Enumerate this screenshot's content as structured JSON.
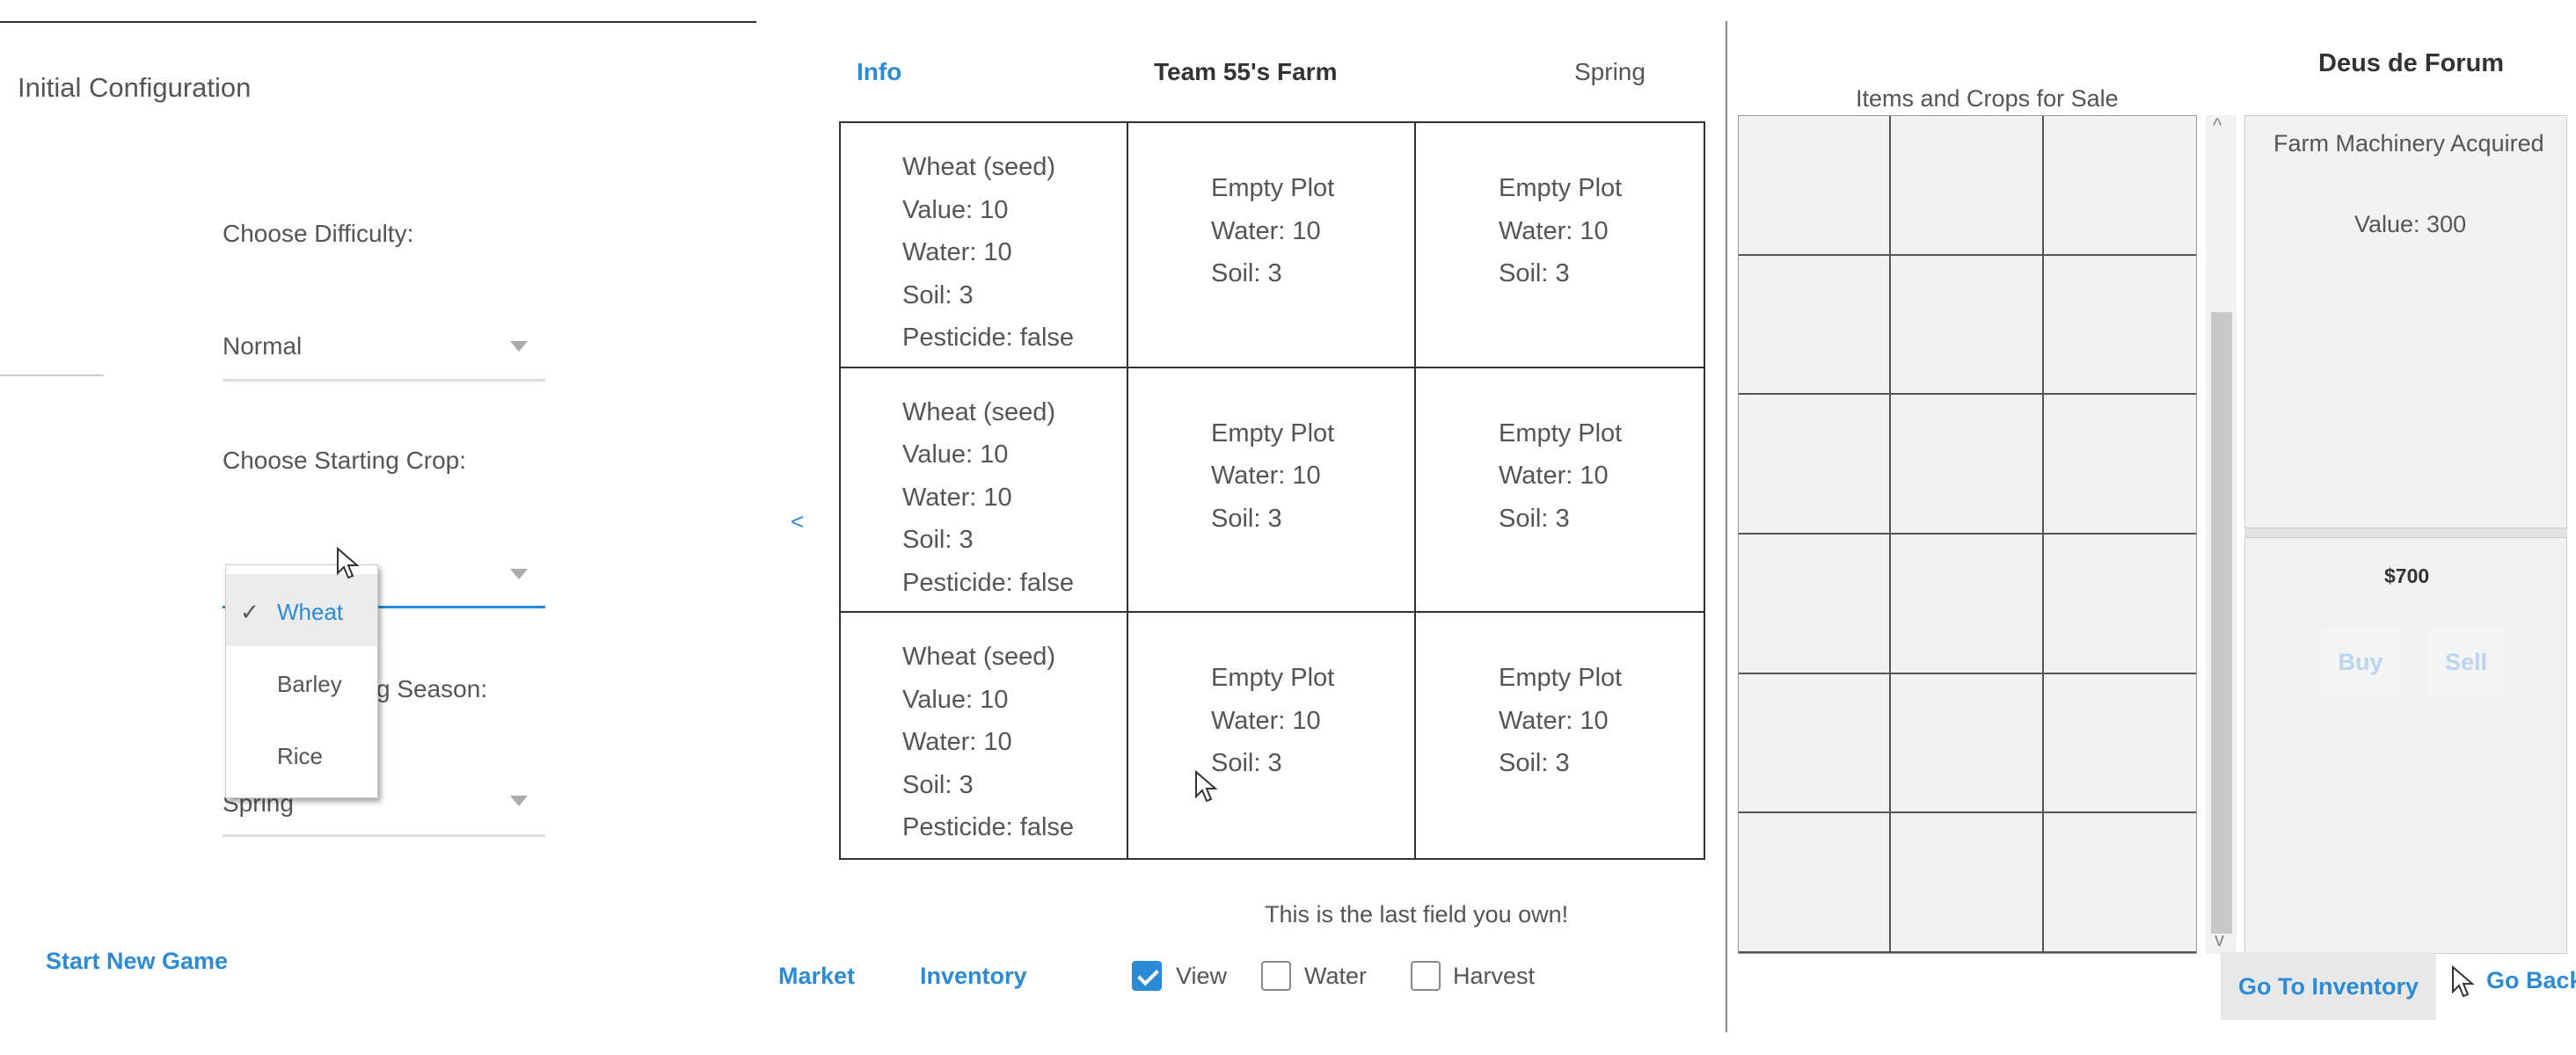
{
  "config": {
    "title": "Initial Configuration",
    "difficulty_label": "Choose Difficulty:",
    "difficulty_value": "Normal",
    "crop_label": "Choose Starting Crop:",
    "season_label_partial": "g Season:",
    "season_value": "Spring",
    "crop_options": [
      "Wheat",
      "Barley",
      "Rice"
    ],
    "crop_selected": "Wheat",
    "checkmark": "✓",
    "start_button": "Start New Game"
  },
  "farm": {
    "info_tab": "Info",
    "title": "Team 55's Farm",
    "season": "Spring",
    "prev_arrow": "<",
    "plots": [
      {
        "type": "seed",
        "lines": [
          "Wheat (seed)",
          "Value: 10",
          "Water: 10",
          "Soil: 3",
          "Pesticide: false"
        ]
      },
      {
        "type": "empty",
        "lines": [
          "Empty Plot",
          "Water: 10",
          "Soil: 3"
        ]
      },
      {
        "type": "empty",
        "lines": [
          "Empty Plot",
          "Water: 10",
          "Soil: 3"
        ]
      },
      {
        "type": "seed",
        "lines": [
          "Wheat (seed)",
          "Value: 10",
          "Water: 10",
          "Soil: 3",
          "Pesticide: false"
        ]
      },
      {
        "type": "empty",
        "lines": [
          "Empty Plot",
          "Water: 10",
          "Soil: 3"
        ]
      },
      {
        "type": "empty",
        "lines": [
          "Empty Plot",
          "Water: 10",
          "Soil: 3"
        ]
      },
      {
        "type": "seed",
        "lines": [
          "Wheat (seed)",
          "Value: 10",
          "Water: 10",
          "Soil: 3",
          "Pesticide: false"
        ]
      },
      {
        "type": "empty",
        "lines": [
          "Empty Plot",
          "Water: 10",
          "Soil: 3"
        ]
      },
      {
        "type": "empty",
        "lines": [
          "Empty Plot",
          "Water: 10",
          "Soil: 3"
        ]
      }
    ],
    "last_field_msg": "This is the last field you own!",
    "nav_market": "Market",
    "nav_inventory": "Inventory",
    "mode_view": "View",
    "mode_water": "Water",
    "mode_harvest": "Harvest",
    "view_checked": true,
    "water_checked": false,
    "harvest_checked": false
  },
  "market": {
    "title": "Deus de Forum",
    "subtitle": "Items and Crops for Sale",
    "item_name": "Farm Machinery Acquired",
    "item_value": "Value: 300",
    "money": "$700",
    "buy": "Buy",
    "sell": "Sell",
    "go_inventory": "Go To Inventory",
    "go_back": "Go Back",
    "scroll_up": "^",
    "scroll_down": "v"
  },
  "colors": {
    "accent": "#2b8bd6",
    "text": "#555555",
    "panel_bg": "#f2f2f2"
  }
}
